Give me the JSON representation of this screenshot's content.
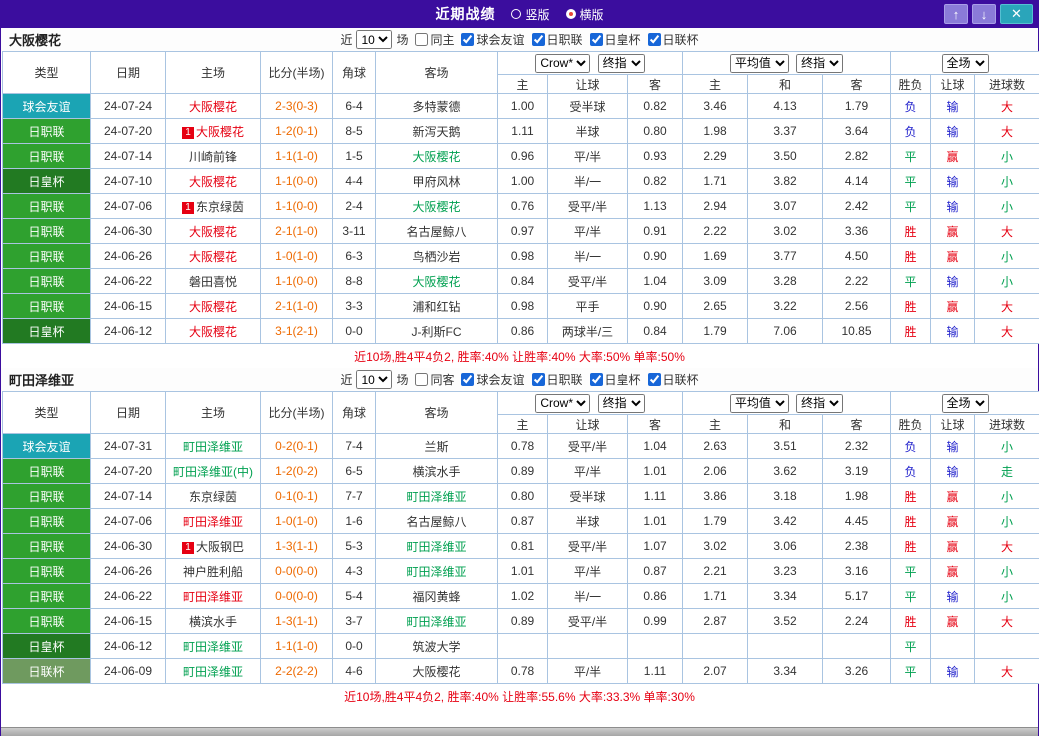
{
  "titlebar": {
    "title": "近期战绩",
    "radios": [
      {
        "label": "竖版",
        "selected": false
      },
      {
        "label": "横版",
        "selected": true
      }
    ],
    "buttons": {
      "up": "↑",
      "down": "↓",
      "close": "✕"
    }
  },
  "filter_labels": {
    "near": "近",
    "games": "场",
    "leagues": [
      "球会友谊",
      "日职联",
      "日皇杯",
      "日联杯"
    ]
  },
  "table_header": {
    "main_cols": [
      "类型",
      "日期",
      "主场",
      "比分(半场)",
      "角球",
      "客场"
    ],
    "odds_group_selects": [
      "Crow*",
      "终指"
    ],
    "avg_group_selects": [
      "平均值",
      "终指"
    ],
    "full_group_select": "全场",
    "sub_cols": [
      "主",
      "让球",
      "客",
      "主",
      "和",
      "客",
      "胜负",
      "让球",
      "进球数"
    ]
  },
  "colors": {
    "topbar_bg": "#3b0d9e",
    "table_border": "#a9c4e1",
    "score_color": "#ee6a00",
    "summary_color": "#e60012",
    "type_colors": {
      "球会友谊": "#1ba4b4",
      "日职联": "#2fa12f",
      "日皇杯": "#227a22",
      "日联杯": "#6f9a5f"
    },
    "team_colors": {
      "red": "#e60012",
      "green": "#00a050",
      "black": "#333333"
    },
    "result_colors": {
      "胜": "#e60012",
      "平": "#00a050",
      "负": "#2222cc",
      "赢": "#e60012",
      "输": "#2222cc",
      "走": "#00a050",
      "大": "#e60012",
      "小": "#00a050"
    }
  },
  "sections": [
    {
      "team": "大阪樱花",
      "filter_count": "10",
      "same_filter_label": "同主",
      "rows": [
        {
          "type": "球会友谊",
          "date": "24-07-24",
          "home": "大阪樱花",
          "home_color": "red",
          "home_badge": "",
          "score": "2-3(0-3)",
          "corner": "6-4",
          "away": "多特蒙德",
          "away_color": "black",
          "away_badge": "",
          "odds": [
            "1.00",
            "受半球",
            "0.82"
          ],
          "avg": [
            "3.46",
            "4.13",
            "1.79"
          ],
          "results": [
            "负",
            "输",
            "大"
          ]
        },
        {
          "type": "日职联",
          "date": "24-07-20",
          "home": "大阪樱花",
          "home_color": "red",
          "home_badge": "1",
          "score": "1-2(0-1)",
          "corner": "8-5",
          "away": "新泻天鹅",
          "away_color": "black",
          "away_badge": "",
          "odds": [
            "1.11",
            "半球",
            "0.80"
          ],
          "avg": [
            "1.98",
            "3.37",
            "3.64"
          ],
          "results": [
            "负",
            "输",
            "大"
          ]
        },
        {
          "type": "日职联",
          "date": "24-07-14",
          "home": "川崎前锋",
          "home_color": "black",
          "home_badge": "",
          "score": "1-1(1-0)",
          "corner": "1-5",
          "away": "大阪樱花",
          "away_color": "green",
          "away_badge": "",
          "odds": [
            "0.96",
            "平/半",
            "0.93"
          ],
          "avg": [
            "2.29",
            "3.50",
            "2.82"
          ],
          "results": [
            "平",
            "赢",
            "小"
          ]
        },
        {
          "type": "日皇杯",
          "date": "24-07-10",
          "home": "大阪樱花",
          "home_color": "red",
          "home_badge": "",
          "score": "1-1(0-0)",
          "corner": "4-4",
          "away": "甲府风林",
          "away_color": "black",
          "away_badge": "",
          "odds": [
            "1.00",
            "半/一",
            "0.82"
          ],
          "avg": [
            "1.71",
            "3.82",
            "4.14"
          ],
          "results": [
            "平",
            "输",
            "小"
          ]
        },
        {
          "type": "日职联",
          "date": "24-07-06",
          "home": "东京绿茵",
          "home_color": "black",
          "home_badge": "1",
          "score": "1-1(0-0)",
          "corner": "2-4",
          "away": "大阪樱花",
          "away_color": "green",
          "away_badge": "",
          "odds": [
            "0.76",
            "受平/半",
            "1.13"
          ],
          "avg": [
            "2.94",
            "3.07",
            "2.42"
          ],
          "results": [
            "平",
            "输",
            "小"
          ]
        },
        {
          "type": "日职联",
          "date": "24-06-30",
          "home": "大阪樱花",
          "home_color": "red",
          "home_badge": "",
          "score": "2-1(1-0)",
          "corner": "3-11",
          "away": "名古屋鲸八",
          "away_color": "black",
          "away_badge": "",
          "odds": [
            "0.97",
            "平/半",
            "0.91"
          ],
          "avg": [
            "2.22",
            "3.02",
            "3.36"
          ],
          "results": [
            "胜",
            "赢",
            "大"
          ]
        },
        {
          "type": "日职联",
          "date": "24-06-26",
          "home": "大阪樱花",
          "home_color": "red",
          "home_badge": "",
          "score": "1-0(1-0)",
          "corner": "6-3",
          "away": "鸟栖沙岩",
          "away_color": "black",
          "away_badge": "",
          "odds": [
            "0.98",
            "半/一",
            "0.90"
          ],
          "avg": [
            "1.69",
            "3.77",
            "4.50"
          ],
          "results": [
            "胜",
            "赢",
            "小"
          ]
        },
        {
          "type": "日职联",
          "date": "24-06-22",
          "home": "磐田喜悦",
          "home_color": "black",
          "home_badge": "",
          "score": "1-1(0-0)",
          "corner": "8-8",
          "away": "大阪樱花",
          "away_color": "green",
          "away_badge": "",
          "odds": [
            "0.84",
            "受平/半",
            "1.04"
          ],
          "avg": [
            "3.09",
            "3.28",
            "2.22"
          ],
          "results": [
            "平",
            "输",
            "小"
          ]
        },
        {
          "type": "日职联",
          "date": "24-06-15",
          "home": "大阪樱花",
          "home_color": "red",
          "home_badge": "",
          "score": "2-1(1-0)",
          "corner": "3-3",
          "away": "浦和红钻",
          "away_color": "black",
          "away_badge": "",
          "odds": [
            "0.98",
            "平手",
            "0.90"
          ],
          "avg": [
            "2.65",
            "3.22",
            "2.56"
          ],
          "results": [
            "胜",
            "赢",
            "大"
          ]
        },
        {
          "type": "日皇杯",
          "date": "24-06-12",
          "home": "大阪樱花",
          "home_color": "red",
          "home_badge": "",
          "score": "3-1(2-1)",
          "corner": "0-0",
          "away": "J-利斯FC",
          "away_color": "black",
          "away_badge": "",
          "odds": [
            "0.86",
            "两球半/三",
            "0.84"
          ],
          "avg": [
            "1.79",
            "7.06",
            "10.85"
          ],
          "results": [
            "胜",
            "输",
            "大"
          ]
        }
      ],
      "summary": "近10场,胜4平4负2, 胜率:40% 让胜率:40% 大率:50% 单率:50%"
    },
    {
      "team": "町田泽维亚",
      "filter_count": "10",
      "same_filter_label": "同客",
      "rows": [
        {
          "type": "球会友谊",
          "date": "24-07-31",
          "home": "町田泽维亚",
          "home_color": "green",
          "home_badge": "",
          "score": "0-2(0-1)",
          "corner": "7-4",
          "away": "兰斯",
          "away_color": "black",
          "away_badge": "",
          "odds": [
            "0.78",
            "受平/半",
            "1.04"
          ],
          "avg": [
            "2.63",
            "3.51",
            "2.32"
          ],
          "results": [
            "负",
            "输",
            "小"
          ]
        },
        {
          "type": "日职联",
          "date": "24-07-20",
          "home": "町田泽维亚(中)",
          "home_color": "green",
          "home_badge": "",
          "score": "1-2(0-2)",
          "corner": "6-5",
          "away": "横滨水手",
          "away_color": "black",
          "away_badge": "",
          "odds": [
            "0.89",
            "平/半",
            "1.01"
          ],
          "avg": [
            "2.06",
            "3.62",
            "3.19"
          ],
          "results": [
            "负",
            "输",
            "走"
          ]
        },
        {
          "type": "日职联",
          "date": "24-07-14",
          "home": "东京绿茵",
          "home_color": "black",
          "home_badge": "",
          "score": "0-1(0-1)",
          "corner": "7-7",
          "away": "町田泽维亚",
          "away_color": "green",
          "away_badge": "",
          "odds": [
            "0.80",
            "受半球",
            "1.11"
          ],
          "avg": [
            "3.86",
            "3.18",
            "1.98"
          ],
          "results": [
            "胜",
            "赢",
            "小"
          ]
        },
        {
          "type": "日职联",
          "date": "24-07-06",
          "home": "町田泽维亚",
          "home_color": "red",
          "home_badge": "",
          "score": "1-0(1-0)",
          "corner": "1-6",
          "away": "名古屋鲸八",
          "away_color": "black",
          "away_badge": "",
          "odds": [
            "0.87",
            "半球",
            "1.01"
          ],
          "avg": [
            "1.79",
            "3.42",
            "4.45"
          ],
          "results": [
            "胜",
            "赢",
            "小"
          ]
        },
        {
          "type": "日职联",
          "date": "24-06-30",
          "home": "大阪钢巴",
          "home_color": "black",
          "home_badge": "1",
          "score": "1-3(1-1)",
          "corner": "5-3",
          "away": "町田泽维亚",
          "away_color": "green",
          "away_badge": "",
          "odds": [
            "0.81",
            "受平/半",
            "1.07"
          ],
          "avg": [
            "3.02",
            "3.06",
            "2.38"
          ],
          "results": [
            "胜",
            "赢",
            "大"
          ]
        },
        {
          "type": "日职联",
          "date": "24-06-26",
          "home": "神户胜利船",
          "home_color": "black",
          "home_badge": "",
          "score": "0-0(0-0)",
          "corner": "4-3",
          "away": "町田泽维亚",
          "away_color": "green",
          "away_badge": "",
          "odds": [
            "1.01",
            "平/半",
            "0.87"
          ],
          "avg": [
            "2.21",
            "3.23",
            "3.16"
          ],
          "results": [
            "平",
            "赢",
            "小"
          ]
        },
        {
          "type": "日职联",
          "date": "24-06-22",
          "home": "町田泽维亚",
          "home_color": "red",
          "home_badge": "",
          "score": "0-0(0-0)",
          "corner": "5-4",
          "away": "福冈黄蜂",
          "away_color": "black",
          "away_badge": "",
          "odds": [
            "1.02",
            "半/一",
            "0.86"
          ],
          "avg": [
            "1.71",
            "3.34",
            "5.17"
          ],
          "results": [
            "平",
            "输",
            "小"
          ]
        },
        {
          "type": "日职联",
          "date": "24-06-15",
          "home": "横滨水手",
          "home_color": "black",
          "home_badge": "",
          "score": "1-3(1-1)",
          "corner": "3-7",
          "away": "町田泽维亚",
          "away_color": "green",
          "away_badge": "",
          "odds": [
            "0.89",
            "受平/半",
            "0.99"
          ],
          "avg": [
            "2.87",
            "3.52",
            "2.24"
          ],
          "results": [
            "胜",
            "赢",
            "大"
          ]
        },
        {
          "type": "日皇杯",
          "date": "24-06-12",
          "home": "町田泽维亚",
          "home_color": "green",
          "home_badge": "",
          "score": "1-1(1-0)",
          "corner": "0-0",
          "away": "筑波大学",
          "away_color": "black",
          "away_badge": "",
          "odds": [
            "",
            "",
            ""
          ],
          "avg": [
            "",
            "",
            ""
          ],
          "results": [
            "平",
            "",
            ""
          ]
        },
        {
          "type": "日联杯",
          "date": "24-06-09",
          "home": "町田泽维亚",
          "home_color": "green",
          "home_badge": "",
          "score": "2-2(2-2)",
          "corner": "4-6",
          "away": "大阪樱花",
          "away_color": "black",
          "away_badge": "",
          "odds": [
            "0.78",
            "平/半",
            "1.11"
          ],
          "avg": [
            "2.07",
            "3.34",
            "3.26"
          ],
          "results": [
            "平",
            "输",
            "大"
          ]
        }
      ],
      "summary": "近10场,胜4平4负2, 胜率:40% 让胜率:55.6% 大率:33.3% 单率:30%"
    }
  ]
}
